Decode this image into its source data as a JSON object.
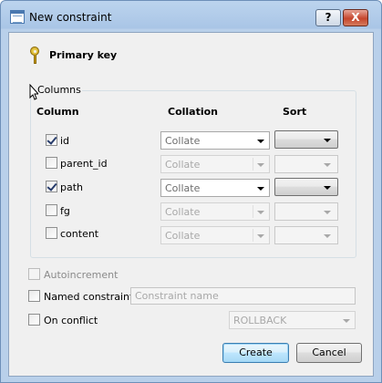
{
  "window": {
    "title": "New constraint",
    "help_glyph": "?",
    "close_glyph": "X"
  },
  "primary_key": {
    "label": "Primary key",
    "icon": "key-icon"
  },
  "columns_group": {
    "label": "Columns",
    "headers": {
      "column": "Column",
      "collation": "Collation",
      "sort": "Sort"
    },
    "rows": [
      {
        "name": "id",
        "checked": true,
        "collation": "Collate",
        "collation_enabled": true,
        "sort": "",
        "sort_enabled": true
      },
      {
        "name": "parent_id",
        "checked": false,
        "collation": "Collate",
        "collation_enabled": false,
        "sort": "",
        "sort_enabled": false
      },
      {
        "name": "path",
        "checked": true,
        "collation": "Collate",
        "collation_enabled": true,
        "sort": "",
        "sort_enabled": true
      },
      {
        "name": "fg",
        "checked": false,
        "collation": "Collate",
        "collation_enabled": false,
        "sort": "",
        "sort_enabled": false
      },
      {
        "name": "content",
        "checked": false,
        "collation": "Collate",
        "collation_enabled": false,
        "sort": "",
        "sort_enabled": false
      }
    ]
  },
  "autoincrement": {
    "label": "Autoincrement",
    "checked": false,
    "enabled": false
  },
  "named_constraint": {
    "label": "Named constraint",
    "checked": false,
    "placeholder": "Constraint name"
  },
  "on_conflict": {
    "label": "On conflict",
    "checked": false,
    "value": "ROLLBACK"
  },
  "buttons": {
    "create": "Create",
    "cancel": "Cancel"
  }
}
